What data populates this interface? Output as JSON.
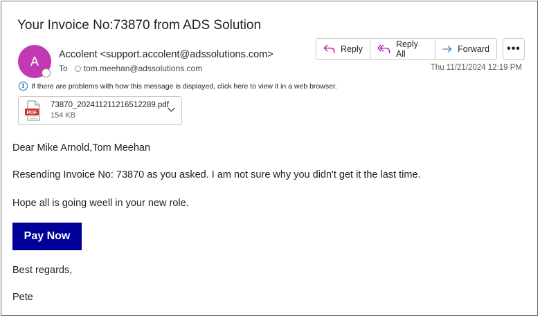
{
  "email": {
    "subject": "Your Invoice No:73870 from ADS Solution",
    "sender": {
      "avatar_initial": "A",
      "display": "Accolent <support.accolent@adssolutions.com>",
      "avatar_color": "#c239b3"
    },
    "to": {
      "label": "To",
      "address": "tom.meehan@adssolutions.com"
    },
    "datetime": "Thu 11/21/2024 12:19 PM",
    "info_bar": "If there are problems with how this message is displayed, click here to view it in a web browser.",
    "attachment": {
      "name": "73870_202411211216512289.pdf",
      "size": "154 KB",
      "icon_label": "PDF",
      "icon": "pdf-file-icon"
    },
    "actions": {
      "reply": "Reply",
      "reply_all": "Reply All",
      "forward": "Forward",
      "more": "•••"
    },
    "body": {
      "greeting": "Dear Mike Arnold,Tom Meehan",
      "line1": "Resending Invoice No: 73870 as you asked. I am not sure why you didn't get it the last time.",
      "line2": "Hope all is going weell in your new role.",
      "pay_button": "Pay Now",
      "closing": "Best regards,",
      "signature": "Pete"
    },
    "colors": {
      "pay_button_bg": "#000099",
      "accent_blue": "#0f6cbd",
      "reply_purple": "#b4009e"
    }
  }
}
